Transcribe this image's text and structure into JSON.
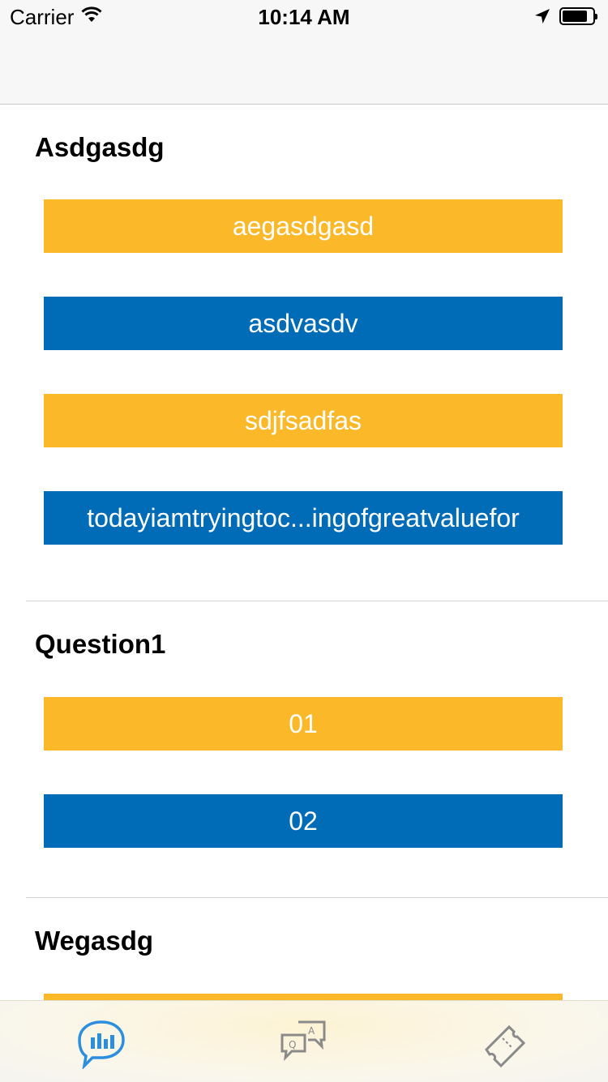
{
  "status_bar": {
    "carrier": "Carrier",
    "time": "10:14 AM",
    "icons": [
      "wifi-icon",
      "location-arrow-icon",
      "battery-icon"
    ]
  },
  "sections": [
    {
      "title": "Asdgasdg",
      "options": [
        {
          "label": "aegasdgasd",
          "color": "#fbb829"
        },
        {
          "label": "asdvasdv",
          "color": "#006bb6"
        },
        {
          "label": "sdjfsadfas",
          "color": "#fbb829"
        },
        {
          "label": "todayiamtryingtoc...ingofgreatvaluefor",
          "color": "#006bb6"
        }
      ]
    },
    {
      "title": "Question1",
      "options": [
        {
          "label": "01",
          "color": "#fbb829"
        },
        {
          "label": "02",
          "color": "#006bb6"
        }
      ]
    },
    {
      "title": "Wegasdg",
      "options": [
        {
          "label": "",
          "color": "#fbb829"
        }
      ]
    }
  ],
  "tab_bar": {
    "tabs": [
      {
        "icon": "chat-bar-chart-icon",
        "selected": true,
        "color": "#2b8fde"
      },
      {
        "icon": "question-answer-bubbles-icon",
        "selected": false,
        "color": "#8a8a8a"
      },
      {
        "icon": "ticket-icon",
        "selected": false,
        "color": "#8a8a8a"
      }
    ]
  }
}
